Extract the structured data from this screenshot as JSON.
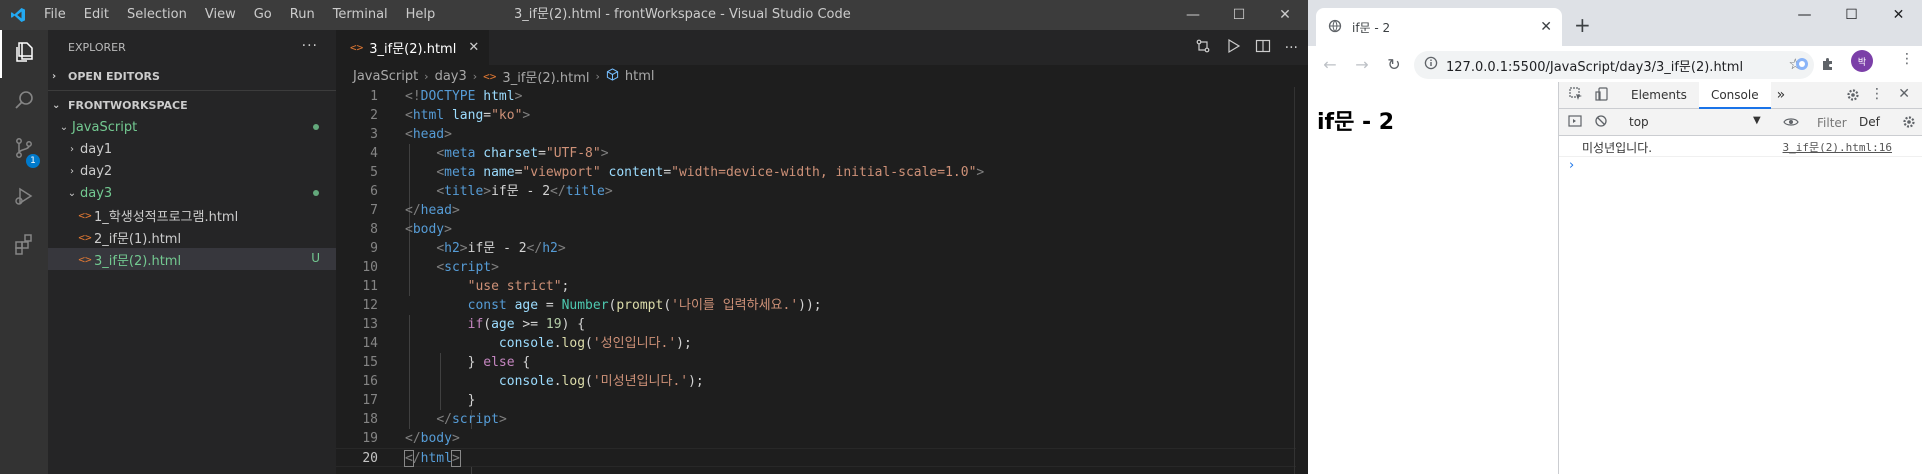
{
  "vscode": {
    "window_title": "3_if문(2).html - frontWorkspace - Visual Studio Code",
    "menu": [
      "File",
      "Edit",
      "Selection",
      "View",
      "Go",
      "Run",
      "Terminal",
      "Help"
    ],
    "window_controls": [
      "—",
      "☐",
      "✕"
    ],
    "activity_badge": "1",
    "explorer": {
      "header": "EXPLORER",
      "more": "···",
      "open_editors": "OPEN EDITORS",
      "workspace": "FRONTWORKSPACE",
      "items": [
        {
          "label": "JavaScript",
          "chevron": "⌄",
          "status": "dot"
        },
        {
          "label": "day1",
          "chevron": "›"
        },
        {
          "label": "day2",
          "chevron": "›"
        },
        {
          "label": "day3",
          "chevron": "⌄",
          "status": "dot"
        },
        {
          "label": "1_학생성적프로그램.html"
        },
        {
          "label": "2_if문(1).html"
        },
        {
          "label": "3_if문(2).html",
          "status": "U"
        }
      ]
    },
    "tab": {
      "icon": "<>",
      "label": "3_if문(2).html",
      "close": "✕"
    },
    "breadcrumbs": [
      "JavaScript",
      "day3",
      "3_if문(2).html",
      "html"
    ],
    "code_lines": [
      "1",
      "2",
      "3",
      "4",
      "5",
      "6",
      "7",
      "8",
      "9",
      "10",
      "11",
      "12",
      "13",
      "14",
      "15",
      "16",
      "17",
      "18",
      "19",
      "20"
    ]
  },
  "chrome": {
    "tab_title": "if문 - 2",
    "tab_close": "✕",
    "new_tab": "+",
    "window_controls": [
      "—",
      "☐",
      "✕"
    ],
    "url": "127.0.0.1:5500/JavaScript/day3/3_if문(2).html",
    "avatar_letter": "박",
    "page_heading": "if문 - 2",
    "devtools": {
      "tabs": [
        "Elements",
        "Console"
      ],
      "more_tabs": "»",
      "context": "top",
      "filter_placeholder": "Filter",
      "levels": "Def",
      "log_message": "미성년입니다.",
      "log_source": "3_if문(2).html:16",
      "prompt": "›"
    }
  }
}
